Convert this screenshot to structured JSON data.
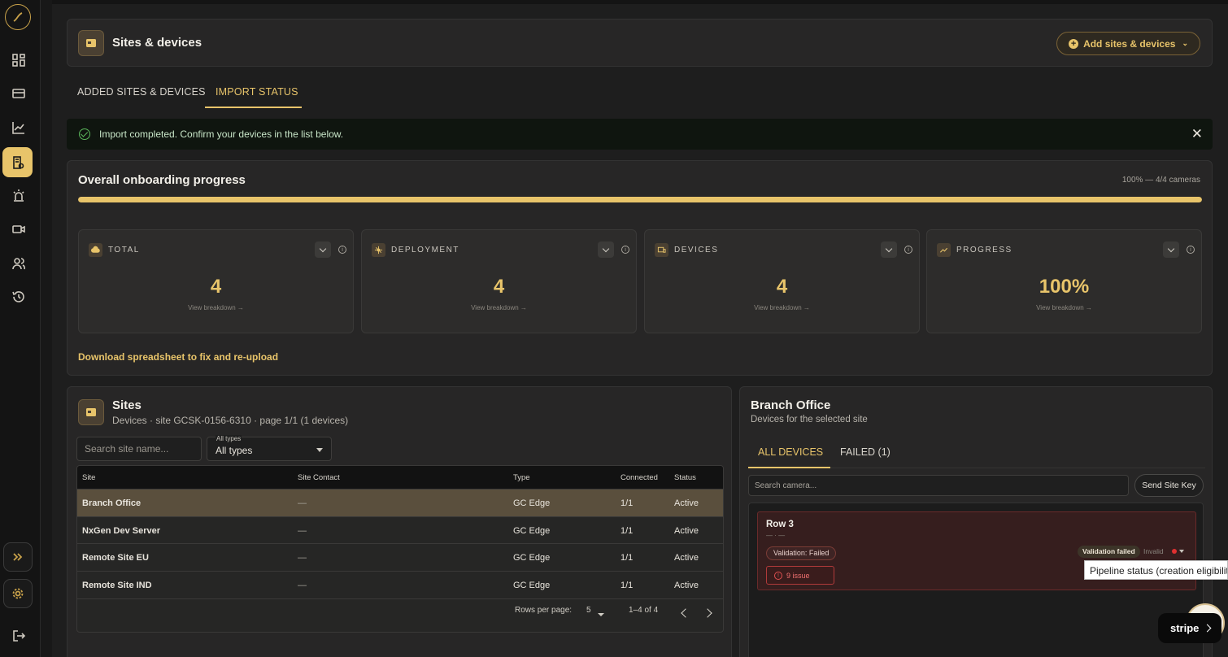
{
  "header": {
    "title": "Sites & devices",
    "add_label": "Add sites & devices"
  },
  "tabs": [
    {
      "label": "ADDED SITES & DEVICES"
    },
    {
      "label": "IMPORT STATUS",
      "active": true
    }
  ],
  "alert": {
    "text": "Import completed. Confirm your devices in the list below."
  },
  "progress": {
    "title": "Overall onboarding progress",
    "meta": "100% — 4/4 cameras",
    "percent": 100,
    "stats": [
      {
        "label": "TOTAL",
        "value": "4",
        "link": "View breakdown →"
      },
      {
        "label": "DEPLOYMENT",
        "value": "4",
        "link": "View breakdown →"
      },
      {
        "label": "DEVICES",
        "value": "4",
        "link": "View breakdown →"
      },
      {
        "label": "PROGRESS",
        "value": "100%",
        "link": "View breakdown →"
      }
    ],
    "download_link": "Download spreadsheet to fix and re-upload"
  },
  "sites": {
    "title": "Sites",
    "subtitle": "Devices · site GCSK-0156-6310 · page 1/1 (1 devices)",
    "search_placeholder": "Search site name...",
    "type_filter": {
      "label": "All types",
      "value": "All types"
    },
    "columns": [
      "Site",
      "Site Contact",
      "Type",
      "Connected",
      "Status"
    ],
    "rows": [
      {
        "site": "Branch Office",
        "contact": "—",
        "type": "GC Edge",
        "connected": "1/1",
        "status": "Active",
        "selected": true
      },
      {
        "site": "NxGen Dev Server",
        "contact": "—",
        "type": "GC Edge",
        "connected": "1/1",
        "status": "Active"
      },
      {
        "site": "Remote Site EU",
        "contact": "—",
        "type": "GC Edge",
        "connected": "1/1",
        "status": "Active"
      },
      {
        "site": "Remote Site IND",
        "contact": "—",
        "type": "GC Edge",
        "connected": "1/1",
        "status": "Active"
      }
    ],
    "pager": {
      "rows_label": "Rows per page:",
      "rows_value": "5",
      "range": "1–4 of 4"
    }
  },
  "branch": {
    "title": "Branch Office",
    "subtitle": "Devices for the selected site",
    "tabs": [
      {
        "label": "ALL DEVICES",
        "active": true
      },
      {
        "label": "FAILED (1)"
      }
    ],
    "search_placeholder": "Search camera...",
    "site_key_label": "Send Site Key",
    "device": {
      "title": "Row 3",
      "dash": "— · —",
      "validation_badge": "Validation: Failed",
      "issues": "9 issue",
      "status_badge": "Validation failed",
      "status_text": "Invalid"
    }
  },
  "tooltip": "Pipeline status (creation eligibility)",
  "stripe_label": "stripe",
  "colors": {
    "accent": "#e8c46a",
    "success": "#5cb85c",
    "error": "#e03030"
  }
}
